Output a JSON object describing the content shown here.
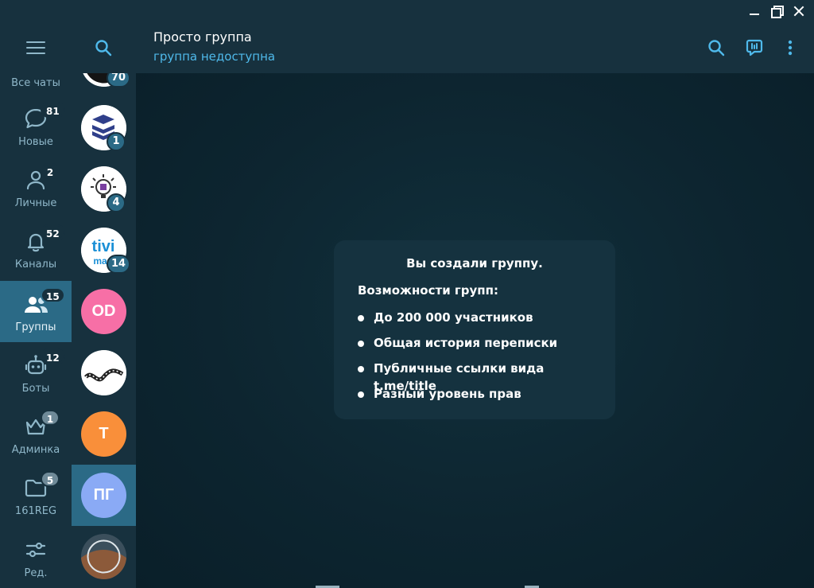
{
  "colors": {
    "sidebar_bg": "#17313e",
    "active_bg": "#2b6a86",
    "accent": "#4fb9ea",
    "icon": "#8fb7c9",
    "message_bg": "#0e2733"
  },
  "window": {
    "controls": [
      "minimize-icon",
      "maximize-icon",
      "close-icon"
    ]
  },
  "folders": {
    "menu_icon": "hamburger-menu-icon",
    "all_chats_label": "Все чаты",
    "items": [
      {
        "label": "Новые",
        "badge": "81",
        "icon": "chat-bubble-icon",
        "active": false,
        "muted": false
      },
      {
        "label": "Личные",
        "badge": "2",
        "icon": "person-icon",
        "active": false,
        "muted": false
      },
      {
        "label": "Каналы",
        "badge": "52",
        "icon": "bell-icon",
        "active": false,
        "muted": false
      },
      {
        "label": "Группы",
        "badge": "15",
        "icon": "people-icon",
        "active": true,
        "muted": false
      },
      {
        "label": "Боты",
        "badge": "12",
        "icon": "bot-icon",
        "active": false,
        "muted": false
      },
      {
        "label": "Админка",
        "badge": "1",
        "icon": "crown-icon",
        "active": false,
        "muted": true
      },
      {
        "label": "161REG",
        "badge": "5",
        "icon": "folder-icon",
        "active": false,
        "muted": true
      },
      {
        "label": "Ред.",
        "badge": "",
        "icon": "sliders-icon",
        "active": false,
        "muted": false
      }
    ]
  },
  "chatlist": {
    "search_icon": "search-icon",
    "chats": [
      {
        "initials": "",
        "badge": "70",
        "avatar": "logo-dark",
        "color": "#ffffff"
      },
      {
        "initials": "",
        "badge": "1",
        "avatar": "logo-stack",
        "color": "#ffffff"
      },
      {
        "initials": "",
        "badge": "4",
        "avatar": "logo-bulb",
        "color": "#ffffff"
      },
      {
        "initials": "",
        "badge": "14",
        "avatar": "logo-tivi",
        "color": "#ffffff"
      },
      {
        "initials": "OD",
        "badge": "",
        "avatar": "initials",
        "color": "#f76fa6"
      },
      {
        "initials": "",
        "badge": "",
        "avatar": "logo-film",
        "color": "#ffffff"
      },
      {
        "initials": "T",
        "badge": "",
        "avatar": "initials",
        "color": "#f98f3a"
      },
      {
        "initials": "ПГ",
        "badge": "",
        "avatar": "initials",
        "color": "#8aaaf5"
      },
      {
        "initials": "",
        "badge": "",
        "avatar": "logo-photo",
        "color": "#334a55"
      }
    ]
  },
  "header": {
    "title": "Просто группа",
    "status": "группа недоступна",
    "icons": [
      "search-icon",
      "voice-chat-icon",
      "more-vert-icon"
    ]
  },
  "service_message": {
    "title": "Вы создали группу.",
    "subtitle": "Возможности групп:",
    "features": [
      "До 200 000 участников",
      "Общая история переписки",
      "Публичные ссылки вида t.me/title",
      "Разный уровень прав"
    ]
  }
}
